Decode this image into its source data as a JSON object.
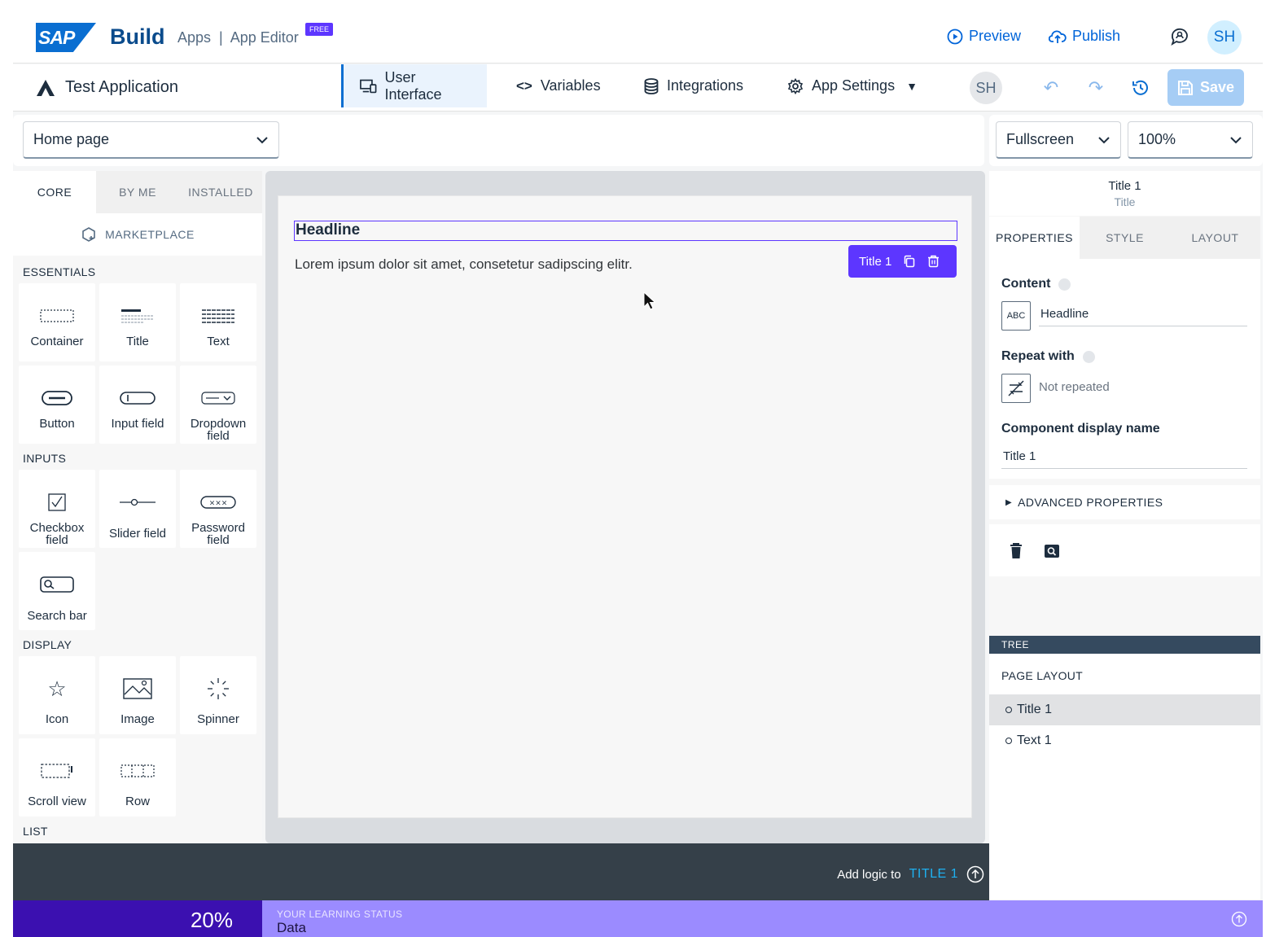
{
  "header": {
    "logo_text": "SAP",
    "brand": "Build",
    "subtitle": "Apps  |  App Editor",
    "badge": "FREE",
    "preview": "Preview",
    "publish": "Publish",
    "avatar": "SH"
  },
  "appbar": {
    "app_name": "Test Application",
    "tabs": [
      "User Interface",
      "Variables",
      "Integrations",
      "App Settings"
    ],
    "collab_avatar": "SH",
    "save": "Save"
  },
  "page_select": {
    "value": "Home page"
  },
  "view_select": {
    "mode": "Fullscreen",
    "zoom": "100%"
  },
  "left_panel": {
    "tabs": [
      "CORE",
      "BY ME",
      "INSTALLED"
    ],
    "marketplace": "MARKETPLACE",
    "sections": {
      "essentials": "ESSENTIALS",
      "inputs": "INPUTS",
      "display": "DISPLAY",
      "list": "LIST"
    },
    "components": {
      "container": "Container",
      "title": "Title",
      "text": "Text",
      "button": "Button",
      "input": "Input field",
      "dropdown": "Dropdown field",
      "checkbox": "Checkbox field",
      "slider": "Slider field",
      "password": "Password field",
      "search": "Search bar",
      "icon": "Icon",
      "image": "Image",
      "spinner": "Spinner",
      "scroll": "Scroll view",
      "row": "Row"
    }
  },
  "canvas": {
    "headline": "Headline",
    "paragraph": "Lorem ipsum dolor sit amet, consetetur sadipscing elitr.",
    "chip_label": "Title 1"
  },
  "right_panel": {
    "component_name": "Title 1",
    "component_type": "Title",
    "tabs": [
      "PROPERTIES",
      "STYLE",
      "LAYOUT"
    ],
    "content_label": "Content",
    "content_value": "Headline",
    "content_icon_text": "ABC",
    "repeat_label": "Repeat with",
    "repeat_value": "Not repeated",
    "display_name_label": "Component display name",
    "display_name_value": "Title 1",
    "advanced": "ADVANCED PROPERTIES",
    "tree_header": "TREE",
    "tree_root": "PAGE LAYOUT",
    "tree_items": [
      "Title 1",
      "Text 1"
    ]
  },
  "logic_bar": {
    "text": "Add logic to",
    "target": "TITLE 1"
  },
  "learning": {
    "percent": "20%",
    "label": "YOUR LEARNING STATUS",
    "value": "Data"
  },
  "colors": {
    "accent": "#0a6ed1",
    "selection": "#5d36ff",
    "learning": "#9b8bff"
  }
}
